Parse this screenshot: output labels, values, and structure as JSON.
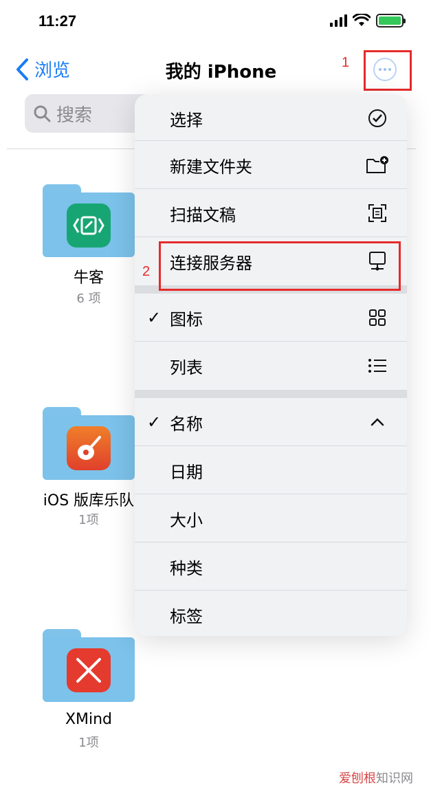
{
  "status": {
    "time": "11:27"
  },
  "nav": {
    "back_label": "浏览",
    "title": "我的 iPhone"
  },
  "annotations": {
    "step1": "1",
    "step2": "2"
  },
  "search": {
    "placeholder": "搜索"
  },
  "folders": [
    {
      "name": "牛客",
      "count": "6 项",
      "app_color": "#17a673"
    },
    {
      "name": "iOS 版库乐队",
      "count": "1项",
      "app_color": "#e8562b"
    },
    {
      "name": "XMind",
      "count": "1项",
      "app_color": "#e53a2e"
    }
  ],
  "menu": {
    "items": [
      {
        "label": "选择",
        "icon": "checkmark-circle-icon"
      },
      {
        "label": "新建文件夹",
        "icon": "folder-plus-icon"
      },
      {
        "label": "扫描文稿",
        "icon": "scan-icon"
      },
      {
        "label": "连接服务器",
        "icon": "server-icon"
      },
      {
        "label": "图标",
        "icon": "grid-icon",
        "checked": true
      },
      {
        "label": "列表",
        "icon": "list-icon"
      },
      {
        "label": "名称",
        "icon": "chevron-up-icon",
        "checked": true
      },
      {
        "label": "日期"
      },
      {
        "label": "大小"
      },
      {
        "label": "种类"
      },
      {
        "label": "标签"
      }
    ],
    "check_mark": "✓"
  },
  "watermark": {
    "part1": "爱刨根",
    "part2": "知识网"
  },
  "colors": {
    "accent": "#1a7cf5",
    "annotation_red": "#e52a2a"
  }
}
